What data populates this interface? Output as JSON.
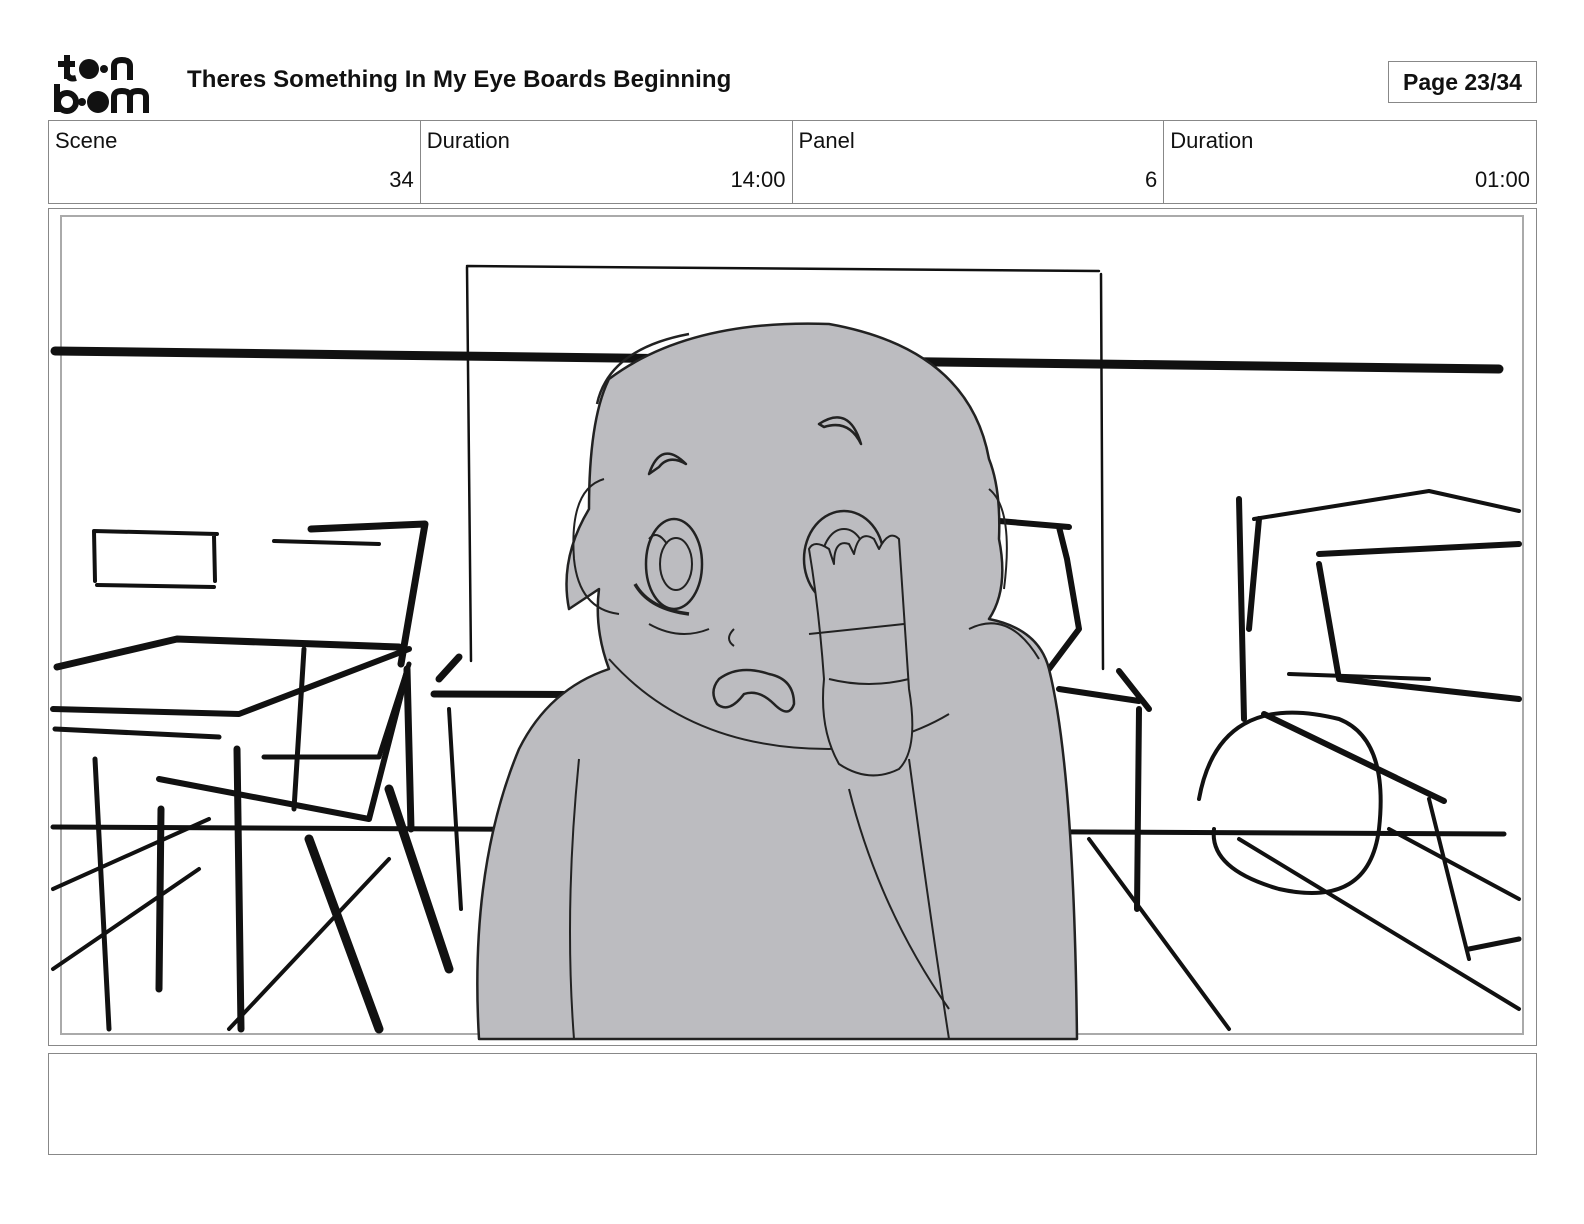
{
  "header": {
    "logo_lines": [
      "toon",
      "boom"
    ],
    "title": "Theres Something In My Eye Boards Beginning",
    "page": "Page 23/34"
  },
  "info": [
    {
      "label": "Scene",
      "value": "34"
    },
    {
      "label": "Duration",
      "value": "14:00"
    },
    {
      "label": "Panel",
      "value": "6"
    },
    {
      "label": "Duration",
      "value": "01:00"
    }
  ],
  "panel": {
    "character_fill": "#bcbcc0",
    "line_color": "#111111"
  },
  "notes": {
    "text": ""
  }
}
